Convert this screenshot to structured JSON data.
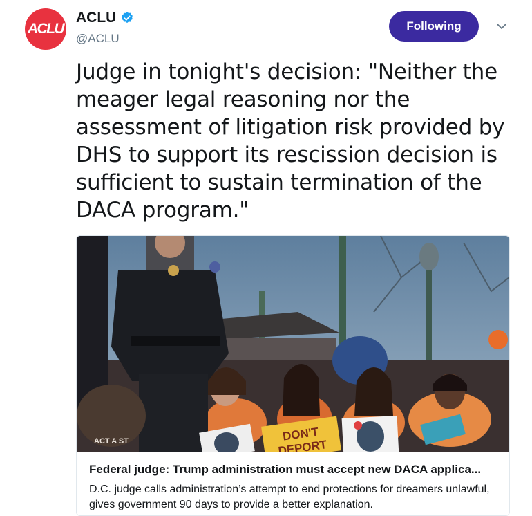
{
  "tweet": {
    "avatar_text": "ACLU",
    "display_name": "ACLU",
    "handle": "@ACLU",
    "verified_icon": "verified-badge-icon",
    "follow_button_label": "Following",
    "caret_icon": "chevron-down-icon",
    "text_lines": [
      "Judge in tonight's decision: \"Neither the",
      "meager legal reasoning nor the",
      "assessment of litigation risk provided by",
      "DHS to support its rescission decision is",
      "sufficient to sustain termination of the",
      "DACA program.\""
    ]
  },
  "card": {
    "image_signs": {
      "dont_line1": "DON'T",
      "dont_line2": "DEPORT",
      "activist": "ACT A ST"
    },
    "title": "Federal judge: Trump administration must accept new DACA applica...",
    "description": "D.C. judge calls administration’s attempt to end protections for dreamers unlawful, gives government 90 days to provide a better explanation."
  },
  "colors": {
    "avatar_red": "#e8323f",
    "follow_button": "#3b2aa0",
    "verified_blue": "#1da1f2",
    "handle_gray": "#657786"
  }
}
